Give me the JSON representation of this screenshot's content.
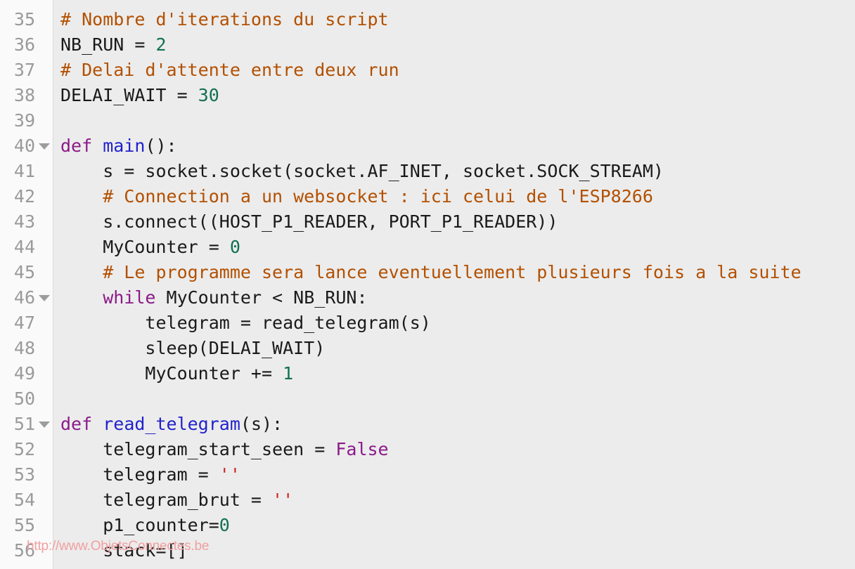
{
  "editor": {
    "language": "python",
    "first_line_number": 35,
    "colors": {
      "background": "#ececec",
      "gutter_background": "#fafafa",
      "gutter_text": "#9a9a9a",
      "text": "#1a1a1a",
      "comment": "#b35000",
      "keyword": "#8b1a89",
      "function": "#2222cc",
      "number": "#11714e",
      "string": "#cc2222",
      "fold_marker": "#9d9d9d"
    }
  },
  "watermark": {
    "text": "http://www.ObjetsConnectes.be",
    "color": "#f0a0a0"
  },
  "lines": [
    {
      "number": "35",
      "fold": false,
      "tokens": [
        {
          "t": "# Nombre d'iterations du script",
          "c": "comment"
        }
      ]
    },
    {
      "number": "36",
      "fold": false,
      "tokens": [
        {
          "t": "NB_RUN = ",
          "c": "plain"
        },
        {
          "t": "2",
          "c": "number"
        }
      ]
    },
    {
      "number": "37",
      "fold": false,
      "tokens": [
        {
          "t": "# Delai d'attente entre deux run",
          "c": "comment"
        }
      ]
    },
    {
      "number": "38",
      "fold": false,
      "tokens": [
        {
          "t": "DELAI_WAIT = ",
          "c": "plain"
        },
        {
          "t": "30",
          "c": "number"
        }
      ]
    },
    {
      "number": "39",
      "fold": false,
      "tokens": [
        {
          "t": "",
          "c": "plain"
        }
      ]
    },
    {
      "number": "40",
      "fold": true,
      "tokens": [
        {
          "t": "def ",
          "c": "keyword"
        },
        {
          "t": "main",
          "c": "func"
        },
        {
          "t": "():",
          "c": "plain"
        }
      ]
    },
    {
      "number": "41",
      "fold": false,
      "tokens": [
        {
          "t": "    s = socket.socket(socket.AF_INET, socket.SOCK_STREAM)",
          "c": "plain"
        }
      ]
    },
    {
      "number": "42",
      "fold": false,
      "tokens": [
        {
          "t": "    # Connection a un websocket : ici celui de l'ESP8266",
          "c": "comment"
        }
      ]
    },
    {
      "number": "43",
      "fold": false,
      "tokens": [
        {
          "t": "    s.connect((HOST_P1_READER, PORT_P1_READER))",
          "c": "plain"
        }
      ]
    },
    {
      "number": "44",
      "fold": false,
      "tokens": [
        {
          "t": "    MyCounter = ",
          "c": "plain"
        },
        {
          "t": "0",
          "c": "number"
        }
      ]
    },
    {
      "number": "45",
      "fold": false,
      "tokens": [
        {
          "t": "    # Le programme sera lance eventuellement plusieurs fois a la suite",
          "c": "comment"
        }
      ]
    },
    {
      "number": "46",
      "fold": true,
      "tokens": [
        {
          "t": "    ",
          "c": "plain"
        },
        {
          "t": "while ",
          "c": "keyword"
        },
        {
          "t": "MyCounter < NB_RUN:",
          "c": "plain"
        }
      ]
    },
    {
      "number": "47",
      "fold": false,
      "tokens": [
        {
          "t": "        telegram = read_telegram(s)",
          "c": "plain"
        }
      ]
    },
    {
      "number": "48",
      "fold": false,
      "tokens": [
        {
          "t": "        sleep(DELAI_WAIT)",
          "c": "plain"
        }
      ]
    },
    {
      "number": "49",
      "fold": false,
      "tokens": [
        {
          "t": "        MyCounter += ",
          "c": "plain"
        },
        {
          "t": "1",
          "c": "number"
        }
      ]
    },
    {
      "number": "50",
      "fold": false,
      "tokens": [
        {
          "t": "",
          "c": "plain"
        }
      ]
    },
    {
      "number": "51",
      "fold": true,
      "tokens": [
        {
          "t": "def ",
          "c": "keyword"
        },
        {
          "t": "read_telegram",
          "c": "func"
        },
        {
          "t": "(s):",
          "c": "plain"
        }
      ]
    },
    {
      "number": "52",
      "fold": false,
      "tokens": [
        {
          "t": "    telegram_start_seen = ",
          "c": "plain"
        },
        {
          "t": "False",
          "c": "keyword"
        }
      ]
    },
    {
      "number": "53",
      "fold": false,
      "tokens": [
        {
          "t": "    telegram = ",
          "c": "plain"
        },
        {
          "t": "''",
          "c": "string"
        }
      ]
    },
    {
      "number": "54",
      "fold": false,
      "tokens": [
        {
          "t": "    telegram_brut = ",
          "c": "plain"
        },
        {
          "t": "''",
          "c": "string"
        }
      ]
    },
    {
      "number": "55",
      "fold": false,
      "tokens": [
        {
          "t": "    p1_counter=",
          "c": "plain"
        },
        {
          "t": "0",
          "c": "number"
        }
      ]
    },
    {
      "number": "56",
      "fold": false,
      "tokens": [
        {
          "t": "    stack=[]",
          "c": "plain"
        }
      ]
    }
  ]
}
